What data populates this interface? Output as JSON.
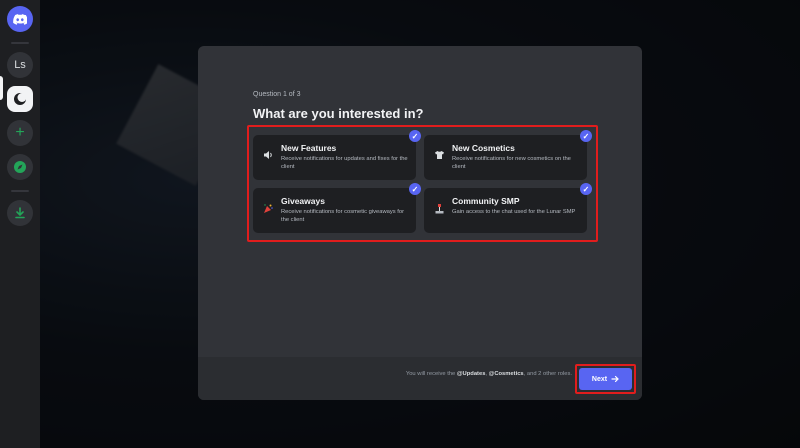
{
  "rail": {
    "items": [
      {
        "label": "",
        "icon": "discord-logo-icon"
      },
      {
        "label": "Ls",
        "icon": ""
      },
      {
        "label": "",
        "icon": "lunar-server-icon"
      },
      {
        "label": "+",
        "icon": "add-server-icon"
      },
      {
        "label": "",
        "icon": "compass-icon"
      },
      {
        "label": "",
        "icon": "download-icon"
      }
    ]
  },
  "onboarding": {
    "counter": "Question 1 of 3",
    "title": "What are you interested in?",
    "options": [
      {
        "title": "New Features",
        "desc": "Receive notifications for updates and fixes for the client",
        "icon": "speaker-icon",
        "checked": true
      },
      {
        "title": "New Cosmetics",
        "desc": "Receive notifications for new cosmetics on the client",
        "icon": "shirt-icon",
        "checked": true
      },
      {
        "title": "Giveaways",
        "desc": "Receive notifications for cosmetic giveaways for the client",
        "icon": "gift-icon",
        "checked": true
      },
      {
        "title": "Community SMP",
        "desc": "Gain access to the chat used for the Lunar SMP",
        "icon": "pickaxe-icon",
        "checked": true
      }
    ],
    "footer": {
      "prefix": "You will receive the ",
      "role1": "@Updates",
      "sep": ", ",
      "role2": "@Cosmetics",
      "suffix": ", and 2 other roles."
    },
    "next_label": "Next"
  },
  "colors": {
    "accent": "#5865f2",
    "highlight": "#e11d1d",
    "green": "#23a559"
  }
}
